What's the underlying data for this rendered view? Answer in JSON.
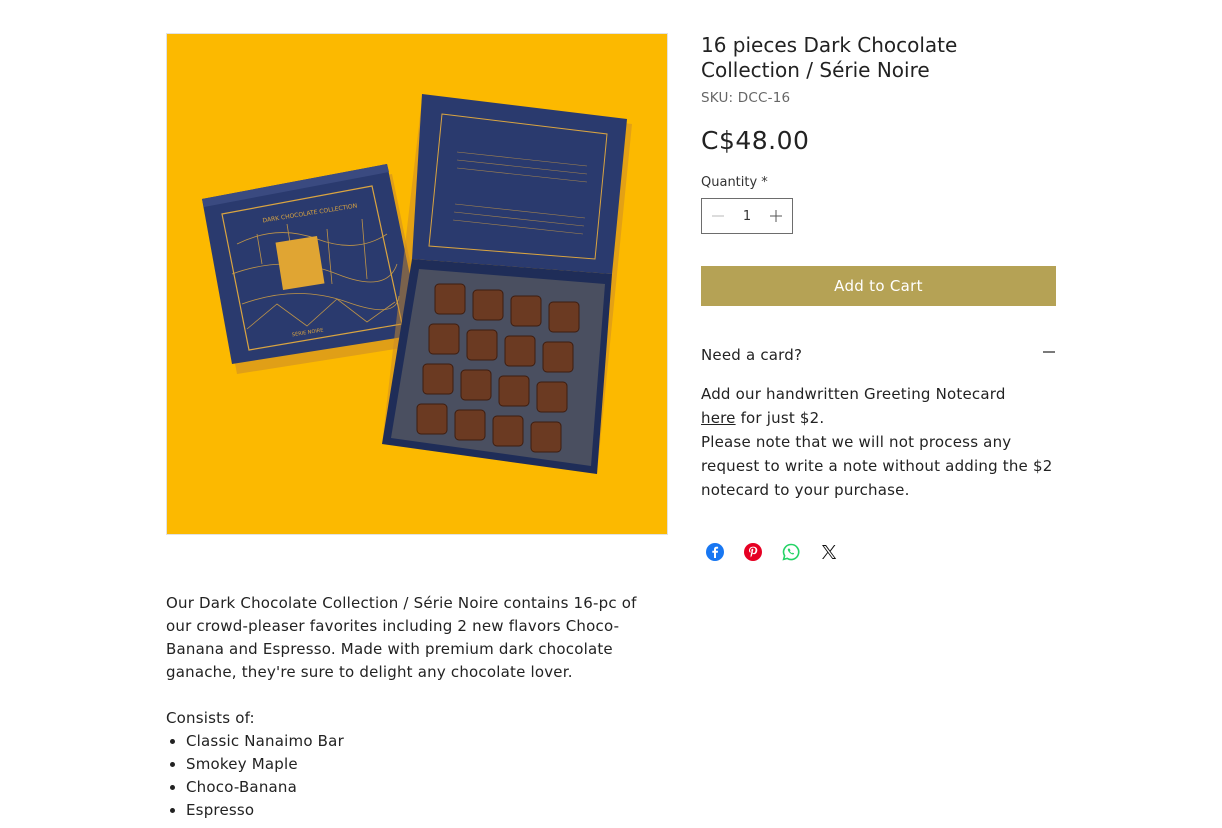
{
  "product": {
    "title": "16 pieces Dark Chocolate Collection / Série Noire",
    "sku": "SKU: DCC-16",
    "price": "C$48.00",
    "quantity_label": "Quantity *",
    "quantity_value": "1",
    "add_to_cart_label": "Add to Cart",
    "image_alt": "Dark Chocolate Collection box with 16 chocolates on yellow background",
    "box_lid_text": "DARK CHOCOLATE COLLECTION",
    "box_lid_subtext": "SÉRIE NOIRE",
    "accent_color": "#b5a255",
    "image_bg_color": "#fcb900"
  },
  "notecard": {
    "header": "Need a card?",
    "line1": "Add our handwritten Greeting Notecard",
    "link_text": "here",
    "line2_rest": " for just $2.",
    "line3": "Please note that we will not process any request to write a note without adding the $2 notecard to your purchase."
  },
  "share": {
    "icons": [
      "facebook-icon",
      "pinterest-icon",
      "whatsapp-icon",
      "x-icon"
    ]
  },
  "description": {
    "intro": "Our Dark Chocolate Collection / Série Noire contains 16-pc of our crowd-pleaser favorites including 2 new flavors Choco-Banana and Espresso. Made with premium dark chocolate ganache, they're sure to delight any chocolate lover.",
    "consists_label": "Consists of:",
    "items": [
      "Classic Nanaimo Bar",
      "Smokey Maple",
      "Choco-Banana",
      "Espresso"
    ]
  }
}
